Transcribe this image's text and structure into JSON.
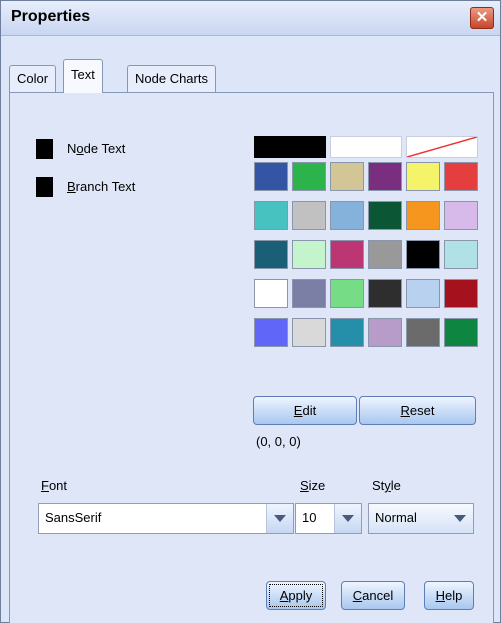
{
  "window": {
    "title": "Properties",
    "close_icon": "close-icon"
  },
  "tabs": [
    {
      "label": "Color",
      "active": false
    },
    {
      "label": "Text",
      "active": true
    },
    {
      "label": "Node Charts",
      "active": false
    }
  ],
  "legend": [
    {
      "label": "Node Text",
      "mnemonic": "o",
      "color": "#000000"
    },
    {
      "label": "Branch Text",
      "mnemonic": "B",
      "color": "#000000"
    }
  ],
  "palette": {
    "top_row": [
      "#000000",
      "#ffffff",
      "none"
    ],
    "rows": [
      [
        "#3455a4",
        "#2db34b",
        "#d2c596",
        "#7a2e7f",
        "#f5f36a",
        "#e53e3e"
      ],
      [
        "#48c1c1",
        "#c1c1c1",
        "#84b2db",
        "#0b5634",
        "#f7961e",
        "#d7b9ea"
      ],
      [
        "#1b5f76",
        "#c3f4cc",
        "#bd3674",
        "#999999",
        "#000000",
        "#b0e1e6"
      ],
      [
        "#ffffff",
        "#7b7fa6",
        "#76dc86",
        "#2e2e2e",
        "#b7d1ef",
        "#a5121e"
      ],
      [
        "#6066f7",
        "#d9d9d9",
        "#258faa",
        "#b79bc9",
        "#6b6b6b",
        "#0e8540"
      ]
    ]
  },
  "buttons": {
    "edit": "Edit",
    "reset": "Reset",
    "apply": "Apply",
    "cancel": "Cancel",
    "help": "Help"
  },
  "rgb_value": "(0, 0, 0)",
  "font": {
    "label": "Font",
    "value": "SansSerif"
  },
  "size": {
    "label": "Size",
    "value": "10"
  },
  "style": {
    "label": "Style",
    "value": "Normal"
  }
}
